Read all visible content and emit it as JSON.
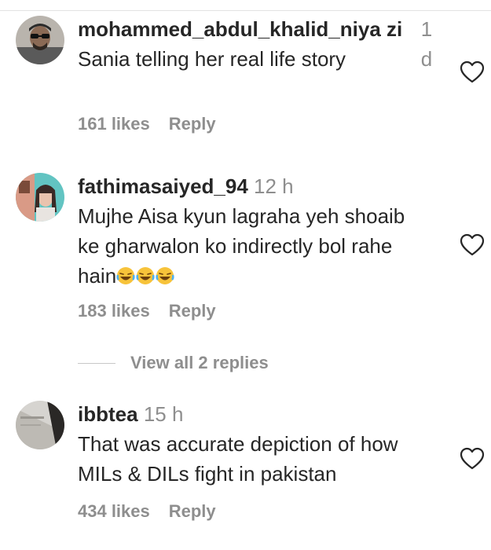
{
  "comments": [
    {
      "username": "mohammed_abdul_khalid_niya zi",
      "time": "1 d",
      "text": "Sania telling her real life story",
      "likes": "161 likes",
      "reply": "Reply"
    },
    {
      "username": "fathimasaiyed_94",
      "time": "12 h",
      "text": "Mujhe Aisa kyun lagraha yeh shoaib ke gharwalon ko indirectly bol rahe hain",
      "emoji": "😂😂😂",
      "likes": "183 likes",
      "reply": "Reply"
    },
    {
      "username": "ibbtea",
      "time": "15 h",
      "text": "That was accurate depiction of how MILs & DILs fight in pakistan",
      "likes": "434 likes",
      "reply": "Reply"
    }
  ],
  "view_replies": "View all 2 replies",
  "icons": {
    "like": "heart-outline-icon"
  },
  "colors": {
    "primary_text": "#262626",
    "secondary_text": "#8e8e8e",
    "divider": "#e3e3e3"
  }
}
